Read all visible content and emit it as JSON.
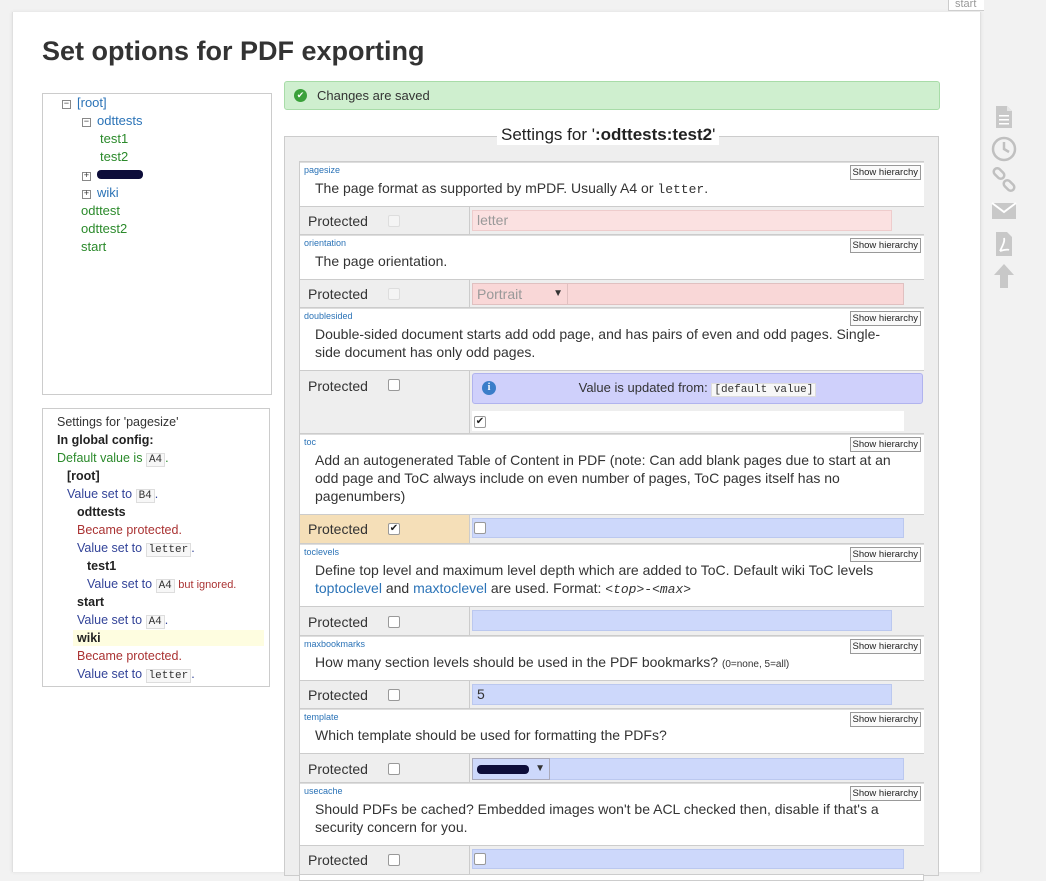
{
  "corner_tab": "start",
  "title": "Set options for PDF exporting",
  "tree": {
    "items": [
      {
        "label": "[root]",
        "kind": "ns",
        "exp": "⊟"
      },
      {
        "label": "odttests",
        "kind": "ns",
        "exp": "⊟"
      },
      {
        "label": "test1",
        "kind": "pg"
      },
      {
        "label": "test2",
        "kind": "pg"
      },
      {
        "label": "",
        "kind": "ns",
        "exp": "⊞"
      },
      {
        "label": "wiki",
        "kind": "ns",
        "exp": "⊞"
      },
      {
        "label": "odttest",
        "kind": "pg"
      },
      {
        "label": "odttest2",
        "kind": "pg"
      },
      {
        "label": "start",
        "kind": "pg"
      }
    ]
  },
  "info": {
    "heading": "Settings for 'pagesize'",
    "global": "In global config:",
    "default_text": "Default value is",
    "default_val": "A4",
    "root": "[root]",
    "root_set": "Value set to",
    "root_val": "B4",
    "odttests": "odttests",
    "became_protected": "Became protected.",
    "odttests_set": "Value set to",
    "odttests_val": "letter",
    "test1": "test1",
    "test1_set": "Value set to",
    "test1_val": "A4",
    "test1_note": "but ignored.",
    "start": "start",
    "start_set": "Value set to",
    "start_val": "A4",
    "wiki": "wiki",
    "wiki_protected": "Became protected.",
    "wiki_set": "Value set to",
    "wiki_val": "letter"
  },
  "success": "Changes are saved",
  "fieldset_legend_prefix": "Settings for '",
  "fieldset_legend_page": ":odttests:test2",
  "fieldset_legend_suffix": "'",
  "show_hierarchy": "Show hierarchy",
  "protected_label": "Protected",
  "settings": {
    "pagesize": {
      "key": "pagesize",
      "desc_a": "The page format as supported by mPDF. Usually ",
      "code1": "A4",
      "desc_b": " or ",
      "code2": "letter",
      "desc_c": ".",
      "value": "letter"
    },
    "orientation": {
      "key": "orientation",
      "desc": "The page orientation.",
      "value": "Portrait"
    },
    "doublesided": {
      "key": "doublesided",
      "desc": "Double-sided document starts add odd page, and has pairs of even and odd pages. Single-side document has only odd pages.",
      "notice": "Value is updated from:",
      "notice_code": "[default value]"
    },
    "toc": {
      "key": "toc",
      "desc": "Add an autogenerated Table of Content in PDF (note: Can add blank pages due to start at an odd page and ToC always include on even number of pages, ToC pages itself has no pagenumbers)"
    },
    "toclevels": {
      "key": "toclevels",
      "desc_a": "Define top level and maximum level depth which are added to ToC. Default wiki ToC levels ",
      "link1": "toptoclevel",
      "desc_b": " and ",
      "link2": "maxtoclevel",
      "desc_c": " are used. Format: ",
      "format": "<top>-<max>"
    },
    "maxbookmarks": {
      "key": "maxbookmarks",
      "desc": "How many section levels should be used in the PDF bookmarks?",
      "hint": "(0=none, 5=all)",
      "value": "5"
    },
    "template": {
      "key": "template",
      "desc": "Which template should be used for formatting the PDFs?"
    },
    "usecache": {
      "key": "usecache",
      "desc": "Should PDFs be cached? Embedded images won't be ACL checked then, disable if that's a security concern for you."
    }
  },
  "toolbar": {
    "icons": [
      "page-icon",
      "history-icon",
      "backlink-icon",
      "email-icon",
      "pdf-icon",
      "top-icon"
    ]
  }
}
